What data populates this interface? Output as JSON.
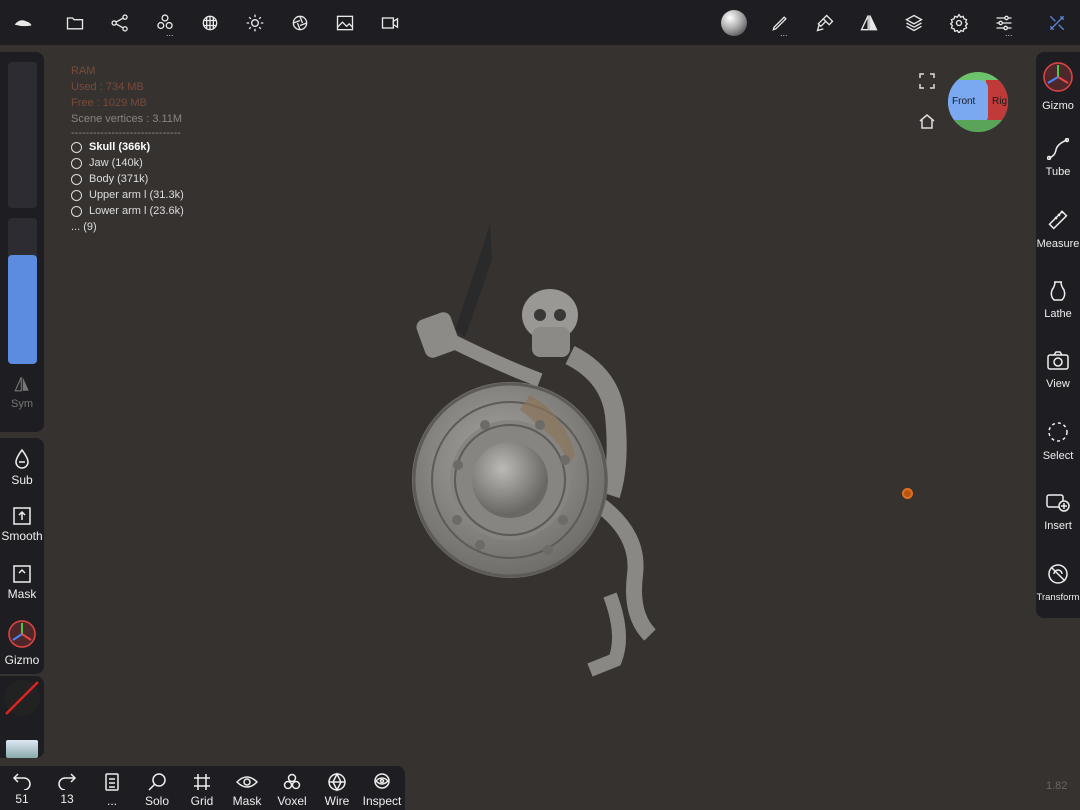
{
  "topbar": {
    "icons": [
      "logo-icon",
      "folder-icon",
      "scene-graph-icon",
      "primitives-icon",
      "material-icon",
      "light-icon",
      "render-icon",
      "background-image-icon",
      "video-icon",
      "matcap-sphere-icon",
      "brush-icon",
      "paint-icon",
      "symmetry-icon",
      "layers-icon",
      "settings-icon",
      "sliders-icon",
      "tools-icon"
    ],
    "more": "..."
  },
  "info": {
    "ram_label": "RAM",
    "used": "Used : 734 MB",
    "free": "Free : 1029 MB",
    "scene_vertices": "Scene vertices : 3.11M",
    "separator": "------------------------------",
    "objects": [
      {
        "name": "Skull (366k)",
        "selected": true
      },
      {
        "name": "Jaw (140k)",
        "selected": false
      },
      {
        "name": "Body (371k)",
        "selected": false
      },
      {
        "name": "Upper arm l (31.3k)",
        "selected": false
      },
      {
        "name": "Lower arm l (23.6k)",
        "selected": false
      }
    ],
    "more": "... (9)"
  },
  "left_panel": {
    "intensity_fraction": 0.75,
    "sym_label": "Sym",
    "tools": {
      "sub": "Sub",
      "smooth": "Smooth",
      "mask": "Mask",
      "gizmo": "Gizmo"
    }
  },
  "right_panel": {
    "gizmo": "Gizmo",
    "tube": "Tube",
    "measure": "Measure",
    "lathe": "Lathe",
    "view": "View",
    "select": "Select",
    "insert": "Insert",
    "transform": "Transform"
  },
  "navcube": {
    "front": "Front",
    "right": "Rig"
  },
  "bottombar": {
    "undo_count": "51",
    "redo_count": "13",
    "more": "...",
    "solo": "Solo",
    "grid": "Grid",
    "mask": "Mask",
    "voxel": "Voxel",
    "wire": "Wire",
    "inspect": "Inspect"
  },
  "version": "1.82",
  "colors": {
    "accent": "#5b8ce0",
    "panel": "#1e1e22",
    "viewport": "#363230",
    "pivot": "#e07020"
  }
}
